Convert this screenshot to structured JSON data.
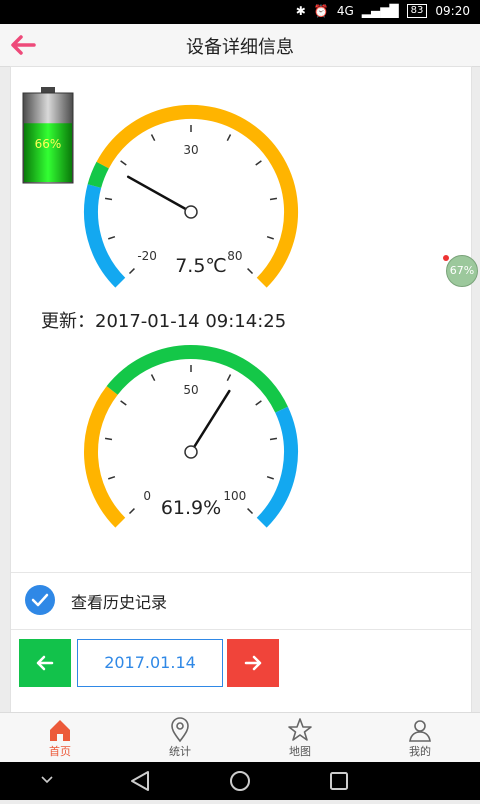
{
  "status_bar": {
    "time": "09:20",
    "battery": "83",
    "network": "4G"
  },
  "header": {
    "title": "设备详细信息"
  },
  "battery_indicator": {
    "label": "66%",
    "level": 0.66
  },
  "temperature_gauge": {
    "value_label": "7.5℃",
    "value": 7.5,
    "ticks": {
      "min": "-20",
      "mid": "30",
      "max": "80"
    },
    "range": [
      -20,
      80
    ],
    "colors": {
      "low": "#13a8f0",
      "mid": "#14c748",
      "high": "#ffb400"
    }
  },
  "update": {
    "text": "更新：2017-01-14 09:14:25"
  },
  "humidity_gauge": {
    "value_label": "61.9%",
    "value": 61.9,
    "ticks": {
      "min": "0",
      "mid": "50",
      "max": "100"
    },
    "range": [
      0,
      100
    ],
    "colors": {
      "low": "#ffb400",
      "mid": "#14c748",
      "high": "#13a8f0"
    }
  },
  "history": {
    "label": "查看历史记录"
  },
  "date_nav": {
    "date": "2017.01.14"
  },
  "tabs": [
    {
      "label": "首页",
      "icon": "home-icon"
    },
    {
      "label": "统计",
      "icon": "location-pin-icon"
    },
    {
      "label": "地图",
      "icon": "star-icon"
    },
    {
      "label": "我的",
      "icon": "user-icon"
    }
  ],
  "floating": {
    "label": "67%"
  }
}
